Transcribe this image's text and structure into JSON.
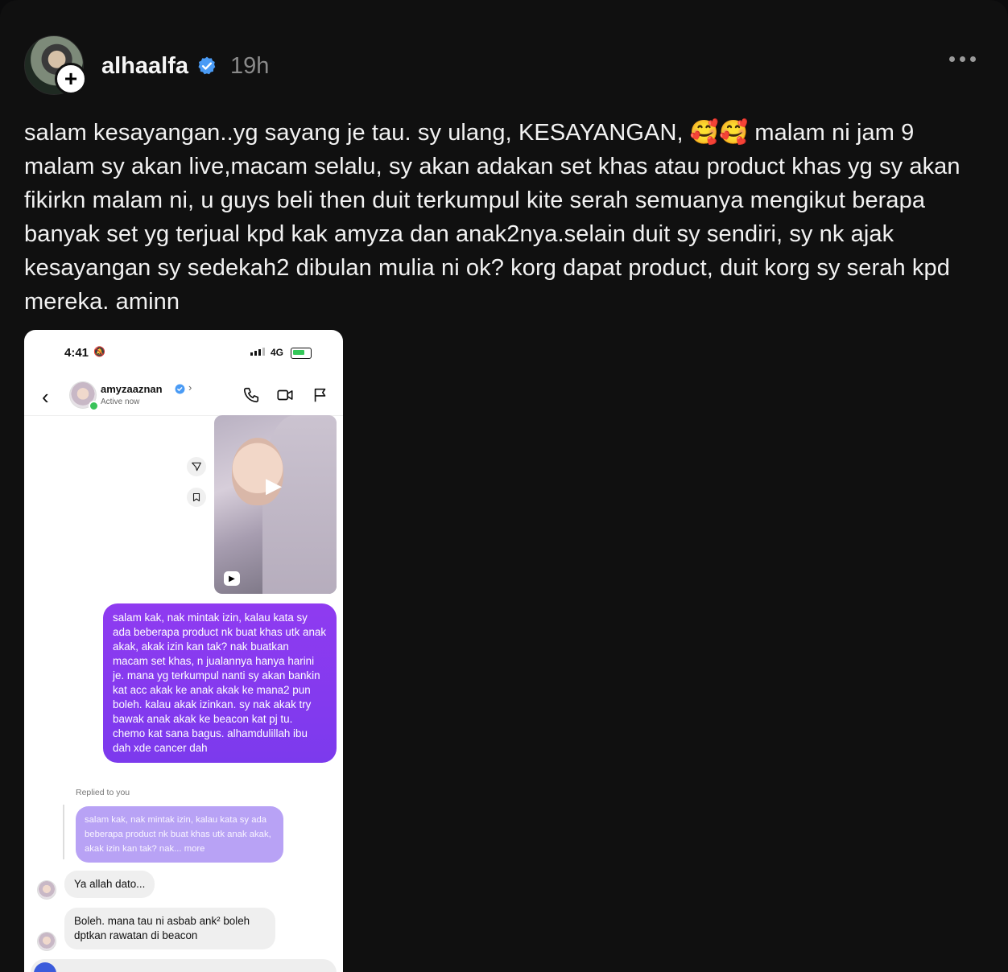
{
  "post": {
    "username": "alhaalfa",
    "verified": true,
    "timestamp": "19h",
    "caption": "salam kesayangan..yg sayang je tau. sy ulang, KESAYANGAN, 🥰🥰 malam ni jam 9 malam sy akan live,macam selalu, sy akan adakan set khas atau product khas yg sy akan fikirkn malam ni, u guys beli then duit terkumpul kite serah semuanya mengikut berapa banyak set yg terjual kpd kak amyza dan anak2nya.selain duit sy sendiri, sy nk ajak kesayangan sy sedekah2 dibulan mulia ni ok? korg dapat product, duit korg sy serah kpd mereka. aminn"
  },
  "colors": {
    "background": "#101010",
    "verified_blue": "#4a9bf5",
    "dm_bubble_purple": "#7c3aed",
    "quote_bubble": "#b8a2f5"
  },
  "screenshot": {
    "status_time": "4:41",
    "network": "4G",
    "contact": {
      "name": "amyzaaznan",
      "status": "Active now",
      "verified": true
    },
    "icons": [
      "back-chevron-icon",
      "phone-icon",
      "video-call-icon",
      "flag-icon",
      "share-icon",
      "bookmark-icon",
      "play-icon",
      "reels-icon"
    ],
    "messages": {
      "sent": "salam kak, nak mintak izin, kalau kata sy ada beberapa product nk buat khas utk anak akak, akak izin kan tak? nak buatkan macam set khas, n jualannya hanya harini je. mana yg terkumpul nanti sy akan bankin kat acc akak ke anak akak ke mana2 pun boleh. kalau akak izinkan. sy nak akak try bawak anak akak ke beacon kat pj tu. chemo kat sana bagus. alhamdulillah ibu dah xde cancer dah",
      "replied_label": "Replied to you",
      "quote": "salam kak, nak mintak izin, kalau kata sy ada beberapa product nk buat khas utk anak akak, akak izin kan tak? nak... more",
      "reply_1": "Ya allah dato...",
      "reply_2": "Boleh. mana tau ni asbab ank² boleh dptkan rawatan di beacon"
    }
  }
}
